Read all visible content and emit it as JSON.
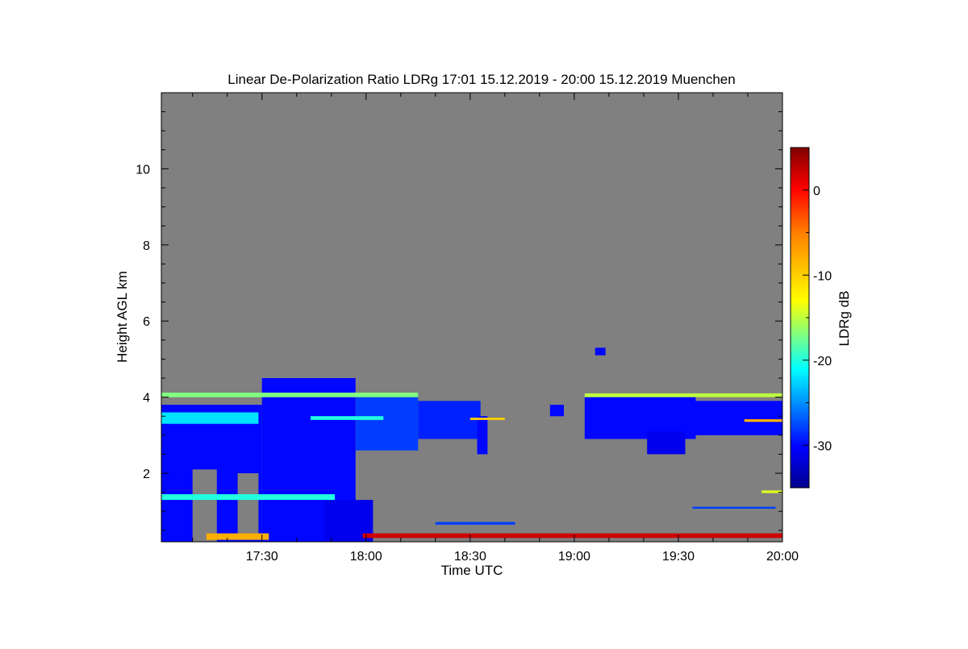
{
  "chart_data": {
    "type": "heatmap",
    "title": "Linear De-Polarization Ratio LDRg   17:01 15.12.2019 - 20:00 15.12.2019 Muenchen",
    "xlabel": "Time UTC",
    "ylabel": "Height AGL km",
    "colorbar_label": "LDRg dB",
    "x_range": [
      "17:01",
      "20:00"
    ],
    "xlim_minutes": [
      1021,
      1200
    ],
    "ylim": [
      0.2,
      12
    ],
    "x_ticks": [
      {
        "label": "17:30",
        "value": 1050
      },
      {
        "label": "18:00",
        "value": 1080
      },
      {
        "label": "18:30",
        "value": 1110
      },
      {
        "label": "19:00",
        "value": 1140
      },
      {
        "label": "19:30",
        "value": 1170
      },
      {
        "label": "20:00",
        "value": 1200
      }
    ],
    "y_ticks": [
      {
        "label": "2",
        "value": 2
      },
      {
        "label": "4",
        "value": 4
      },
      {
        "label": "6",
        "value": 6
      },
      {
        "label": "8",
        "value": 8
      },
      {
        "label": "10",
        "value": 10
      }
    ],
    "colorbar": {
      "range": [
        -35,
        5
      ],
      "ticks": [
        {
          "label": "0",
          "value": 0
        },
        {
          "label": "-10",
          "value": -10
        },
        {
          "label": "-20",
          "value": -20
        },
        {
          "label": "-30",
          "value": -30
        }
      ],
      "colormap": "jet"
    },
    "background_color": "#808080",
    "regions": [
      {
        "t0": 1021,
        "t1": 1050,
        "h0": 0.2,
        "h1": 3.8,
        "ldr": -30
      },
      {
        "t0": 1030,
        "t1": 1037,
        "h0": 0.2,
        "h1": 2.1,
        "ldr": null
      },
      {
        "t0": 1043,
        "t1": 1049,
        "h0": 0.3,
        "h1": 2.0,
        "ldr": null
      },
      {
        "t0": 1050,
        "t1": 1077,
        "h0": 0.2,
        "h1": 4.5,
        "ldr": -30
      },
      {
        "t0": 1068,
        "t1": 1082,
        "h0": 0.2,
        "h1": 1.3,
        "ldr": -31
      },
      {
        "t0": 1077,
        "t1": 1095,
        "h0": 2.6,
        "h1": 4.1,
        "ldr": -28
      },
      {
        "t0": 1095,
        "t1": 1113,
        "h0": 2.9,
        "h1": 3.9,
        "ldr": -29
      },
      {
        "t0": 1112,
        "t1": 1115,
        "h0": 2.5,
        "h1": 3.5,
        "ldr": -30
      },
      {
        "t0": 1143,
        "t1": 1175,
        "h0": 2.9,
        "h1": 4.0,
        "ldr": -30
      },
      {
        "t0": 1167,
        "t1": 1200,
        "h0": 3.0,
        "h1": 3.9,
        "ldr": -30
      },
      {
        "t0": 1161,
        "t1": 1172,
        "h0": 2.5,
        "h1": 3.1,
        "ldr": -31
      },
      {
        "t0": 1133,
        "t1": 1137,
        "h0": 3.5,
        "h1": 3.8,
        "ldr": -30
      },
      {
        "t0": 1146,
        "t1": 1149,
        "h0": 5.1,
        "h1": 5.3,
        "ldr": -30
      },
      {
        "t0": 1021,
        "t1": 1071,
        "h0": 1.3,
        "h1": 1.45,
        "ldr": -20
      },
      {
        "t0": 1021,
        "t1": 1095,
        "h0": 4.0,
        "h1": 4.12,
        "ldr": -17
      },
      {
        "t0": 1143,
        "t1": 1200,
        "h0": 4.0,
        "h1": 4.1,
        "ldr": -15
      },
      {
        "t0": 1079,
        "t1": 1200,
        "h0": 0.3,
        "h1": 0.42,
        "ldr": 2
      },
      {
        "t0": 1034,
        "t1": 1052,
        "h0": 0.25,
        "h1": 0.42,
        "ldr": -8
      },
      {
        "t0": 1100,
        "t1": 1123,
        "h0": 0.65,
        "h1": 0.72,
        "ldr": -28
      },
      {
        "t0": 1174,
        "t1": 1198,
        "h0": 1.07,
        "h1": 1.12,
        "ldr": -28
      },
      {
        "t0": 1194,
        "t1": 1200,
        "h0": 1.48,
        "h1": 1.55,
        "ldr": -14
      },
      {
        "t0": 1021,
        "t1": 1049,
        "h0": 3.3,
        "h1": 3.6,
        "ldr": -22
      },
      {
        "t0": 1064,
        "t1": 1085,
        "h0": 3.4,
        "h1": 3.5,
        "ldr": -20
      },
      {
        "t0": 1110,
        "t1": 1120,
        "h0": 3.4,
        "h1": 3.46,
        "ldr": -10
      },
      {
        "t0": 1189,
        "t1": 1200,
        "h0": 3.35,
        "h1": 3.42,
        "ldr": -8
      }
    ]
  }
}
